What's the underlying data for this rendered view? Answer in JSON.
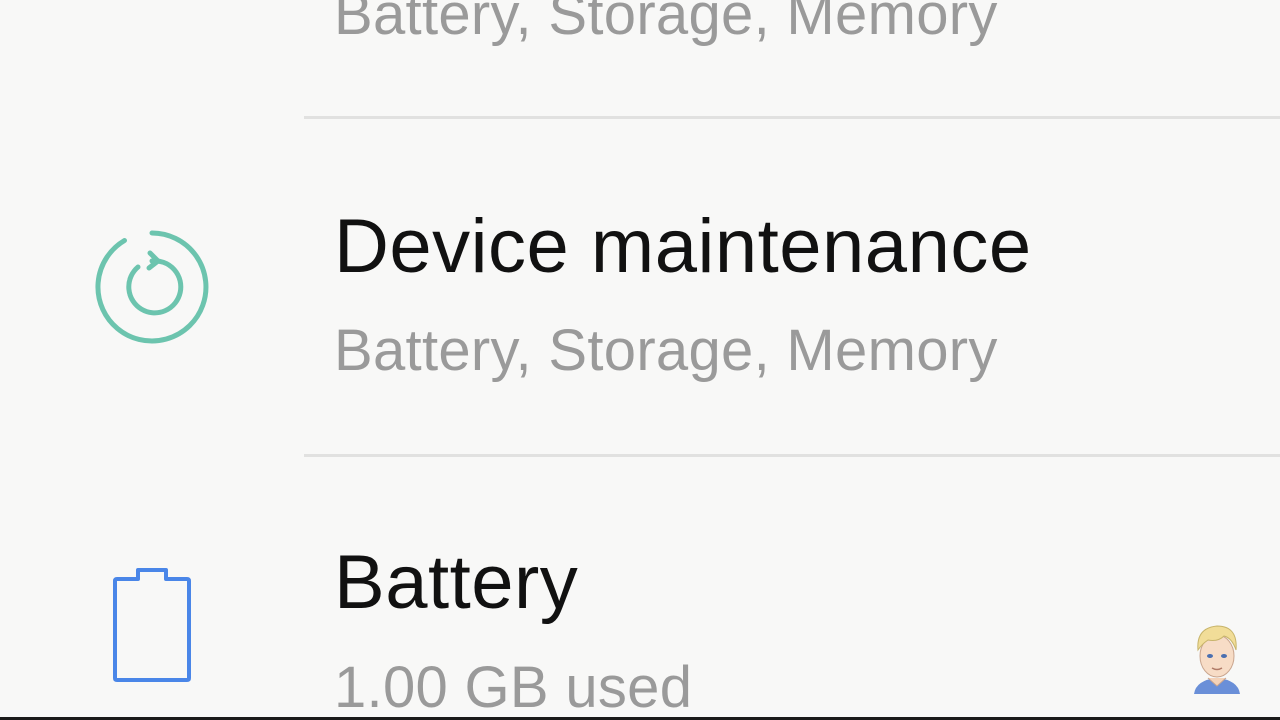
{
  "settings_list": {
    "items": [
      {
        "subtitle": "Battery, Storage, Memory"
      },
      {
        "title": "Device maintenance",
        "subtitle": "Battery, Storage, Memory",
        "icon": "device-maintenance-icon",
        "icon_color": "#6cc4ae"
      },
      {
        "title": "Battery",
        "subtitle": "1.00 GB used",
        "icon": "battery-icon",
        "icon_color": "#4a86e8"
      }
    ]
  },
  "colors": {
    "background": "#f8f8f7",
    "title_text": "#111111",
    "subtitle_text": "#9a9a9a",
    "divider": "#e1e1e0"
  }
}
